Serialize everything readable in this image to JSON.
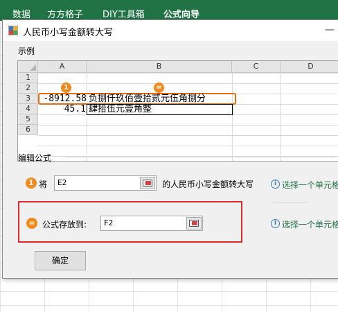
{
  "ribbon": {
    "tabs": [
      "数据",
      "方方格子",
      "DIY工具箱",
      "公式向导"
    ],
    "active_tab": "公式向导",
    "color": "#217346"
  },
  "dialog": {
    "title": "人民币小写金额转大写",
    "minimize_glyph": "—",
    "example_group_label": "示例",
    "edit_group_label": "编辑公式",
    "ok_label": "确定"
  },
  "example_grid": {
    "columns": [
      "A",
      "B",
      "C",
      "D"
    ],
    "rows": [
      "1",
      "2",
      "3",
      "4",
      "5",
      "6"
    ],
    "badge_source": "1",
    "badge_result": "=",
    "cells": {
      "A3": "-8912.58",
      "B3": "负捌仟玖佰壹拾贰元伍角捌分",
      "A4": "45.1",
      "B4": "肆拾伍元壹角整"
    },
    "highlight_color": "#e46c0a"
  },
  "edit": {
    "source_badge": "1",
    "source_prefix": "将",
    "source_value": "E2",
    "source_suffix": "的人民币小写金额转大写",
    "source_hint": "选择一个单元格",
    "dest_badge": "=",
    "dest_label": "公式存放到:",
    "dest_value": "F2",
    "dest_hint": "选择一个单元格",
    "hint_color": "#217346",
    "frame_color": "#e02a2a"
  }
}
